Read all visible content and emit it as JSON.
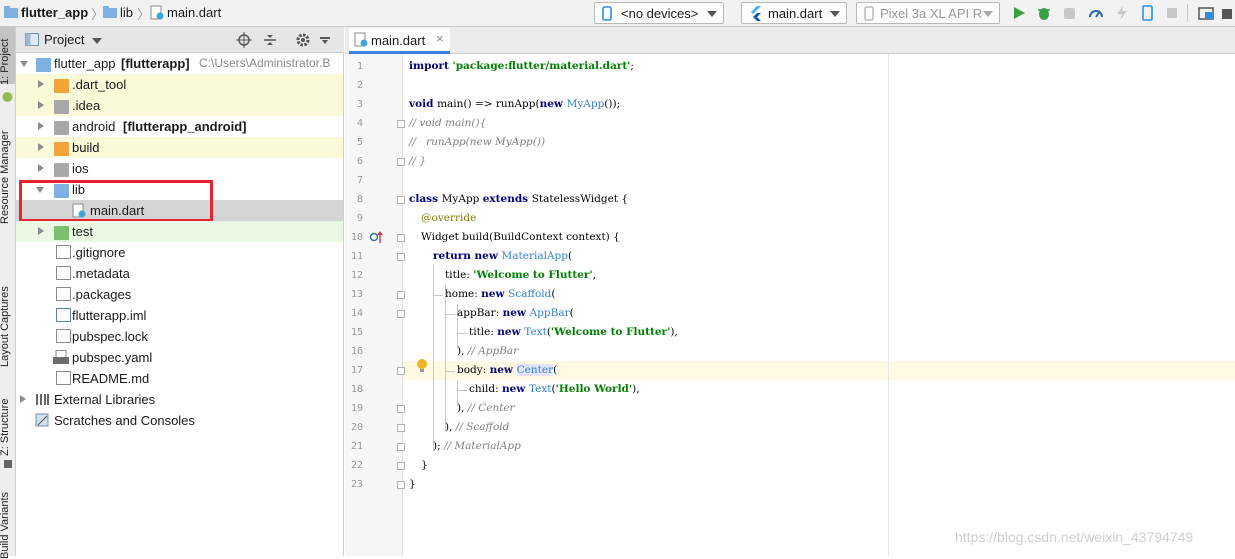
{
  "breadcrumb": [
    "flutter_app",
    "lib",
    "main.dart"
  ],
  "toolbar": {
    "device_selector": "<no devices>",
    "run_config": "main.dart",
    "emulator": "Pixel 3a XL API R"
  },
  "side_tabs": [
    "1: Project",
    "Resource Manager",
    "Layout Captures",
    "Z: Structure",
    "Build Variants"
  ],
  "project_panel": {
    "title": "Project",
    "tree": [
      {
        "label": "flutter_app",
        "bold": "[flutterapp]",
        "extra": "C:\\Users\\Administrator.B"
      },
      {
        "label": ".dart_tool"
      },
      {
        "label": ".idea"
      },
      {
        "label": "android",
        "bold": "[flutterapp_android]"
      },
      {
        "label": "build"
      },
      {
        "label": "ios"
      },
      {
        "label": "lib"
      },
      {
        "label": "main.dart"
      },
      {
        "label": "test"
      },
      {
        "label": ".gitignore"
      },
      {
        "label": ".metadata"
      },
      {
        "label": ".packages"
      },
      {
        "label": "flutterapp.iml"
      },
      {
        "label": "pubspec.lock"
      },
      {
        "label": "pubspec.yaml"
      },
      {
        "label": "README.md"
      },
      {
        "label": "External Libraries"
      },
      {
        "label": "Scratches and Consoles"
      }
    ]
  },
  "editor": {
    "tab": "main.dart",
    "line_numbers": [
      "1",
      "2",
      "3",
      "4",
      "5",
      "6",
      "7",
      "8",
      "9",
      "10",
      "11",
      "12",
      "13",
      "14",
      "15",
      "16",
      "17",
      "18",
      "19",
      "20",
      "21",
      "22",
      "23"
    ],
    "code": {
      "l1a": "import ",
      "l1b": "'package:flutter/material.dart'",
      "l1c": ";",
      "l3a": "void ",
      "l3b": "main() => runApp(",
      "l3c": "new ",
      "l3d": "MyApp",
      "l3e": "());",
      "l4": "// void main(){",
      "l5": "//   runApp(new MyApp())",
      "l6": "// }",
      "l8a": "class ",
      "l8b": "MyApp ",
      "l8c": "extends ",
      "l8d": "StatelessWidget {",
      "l9": "@override",
      "l10": "Widget build(BuildContext context) {",
      "l11a": "return new ",
      "l11b": "MaterialApp",
      "l11c": "(",
      "l12a": "title: ",
      "l12b": "'Welcome to Flutter'",
      "l12c": ",",
      "l13a": "home: ",
      "l13b": "new ",
      "l13c": "Scaffold",
      "l13d": "(",
      "l14a": "appBar: ",
      "l14b": "new ",
      "l14c": "AppBar",
      "l14d": "(",
      "l15a": "title: ",
      "l15b": "new ",
      "l15c": "Text",
      "l15d": "(",
      "l15e": "'Welcome to Flutter'",
      "l15f": "),",
      "l16a": "), ",
      "l16b": "// AppBar",
      "l17a": "body: ",
      "l17b": "new ",
      "l17c": "Center",
      "l17d": "(",
      "l18a": "child: ",
      "l18b": "new ",
      "l18c": "Text",
      "l18d": "(",
      "l18e": "'Hello World'",
      "l18f": "),",
      "l19a": "), ",
      "l19b": "// Center",
      "l20a": "), ",
      "l20b": "// Scaffold",
      "l21a": "); ",
      "l21b": "// MaterialApp",
      "l22": "}",
      "l23": "}"
    }
  },
  "watermark": "https://blog.csdn.net/weixin_43794749",
  "colors": {
    "highlight_box": "#e8232e",
    "selected_row": "#d5d5d5",
    "folder_orange": "#f2a33a",
    "folder_blue": "#7fb1e0"
  }
}
